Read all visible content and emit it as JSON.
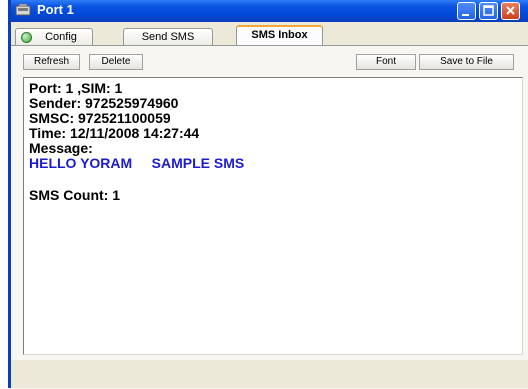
{
  "window": {
    "title": "Port 1"
  },
  "tabs": [
    {
      "label": "Config",
      "active": false
    },
    {
      "label": "Send SMS",
      "active": false
    },
    {
      "label": "SMS Inbox",
      "active": true
    }
  ],
  "toolbar": {
    "refresh_label": "Refresh",
    "delete_label": "Delete",
    "font_label": "Font",
    "save_label": "Save to File"
  },
  "inbox": {
    "port_sim": "Port: 1 ,SIM: 1",
    "sender": "Sender: 972525974960",
    "smsc": "SMSC: 972521100059",
    "time": "Time: 12/11/2008 14:27:44",
    "message_label": "Message:",
    "message_text": "HELLO YORAM     SAMPLE SMS",
    "count": "SMS Count: 1"
  },
  "colors": {
    "titlebar": "#0a54e3",
    "message_text": "#1c1ccf",
    "active_tab_accent": "#f1a83d"
  }
}
